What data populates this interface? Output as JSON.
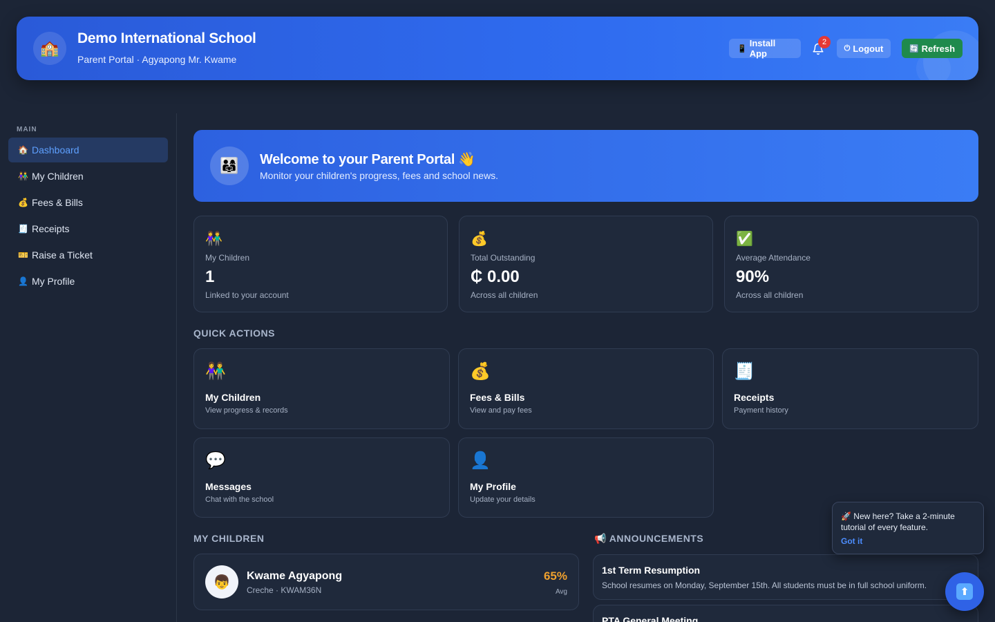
{
  "header": {
    "logo_icon": "🏫",
    "title": "Demo International School",
    "subtitle": "Parent Portal · Agyapong Mr. Kwame",
    "install_icon": "📱",
    "install_label": "Install App",
    "notification_count": "2",
    "logout_icon": "⏻",
    "logout_label": "Logout",
    "refresh_icon": "🔄",
    "refresh_label": "Refresh"
  },
  "sidebar": {
    "section": "MAIN",
    "items": [
      {
        "icon": "🏠",
        "label": "Dashboard",
        "active": true
      },
      {
        "icon": "👫",
        "label": "My Children"
      },
      {
        "icon": "💰",
        "label": "Fees & Bills"
      },
      {
        "icon": "🧾",
        "label": "Receipts"
      },
      {
        "icon": "🎫",
        "label": "Raise a Ticket"
      },
      {
        "icon": "👤",
        "label": "My Profile"
      }
    ]
  },
  "welcome": {
    "avatar_icon": "👨‍👩‍👧",
    "title": "Welcome to your Parent Portal 👋",
    "subtitle": "Monitor your children's progress, fees and school news."
  },
  "stats": [
    {
      "icon": "👫",
      "label": "My Children",
      "value": "1",
      "note": "Linked to your account"
    },
    {
      "icon": "💰",
      "label": "Total Outstanding",
      "value": "₵ 0.00",
      "note": "Across all children"
    },
    {
      "icon": "✅",
      "label": "Average Attendance",
      "value": "90%",
      "note": "Across all children"
    }
  ],
  "quick_actions": {
    "title": "QUICK ACTIONS",
    "items": [
      {
        "icon": "👫",
        "title": "My Children",
        "desc": "View progress & records"
      },
      {
        "icon": "💰",
        "title": "Fees & Bills",
        "desc": "View and pay fees"
      },
      {
        "icon": "🧾",
        "title": "Receipts",
        "desc": "Payment history"
      },
      {
        "icon": "💬",
        "title": "Messages",
        "desc": "Chat with the school"
      },
      {
        "icon": "👤",
        "title": "My Profile",
        "desc": "Update your details"
      }
    ]
  },
  "children": {
    "title": "MY CHILDREN",
    "items": [
      {
        "avatar_icon": "👦",
        "name": "Kwame Agyapong",
        "meta": "Creche · KWAM36N",
        "avg": "65%",
        "avg_label": "Avg"
      }
    ]
  },
  "announcements": {
    "title": "📢 ANNOUNCEMENTS",
    "items": [
      {
        "title": "1st Term Resumption",
        "desc": "School resumes on Monday, September 15th. All students must be in full school uniform."
      },
      {
        "title": "PTA General Meeting",
        "desc": ""
      }
    ]
  },
  "tutorial": {
    "message": "🚀 New here? Take a 2-minute tutorial of every feature.",
    "action": "Got it"
  },
  "fab": {
    "icon": "⬆"
  },
  "colors": {
    "accent": "#2f6cf0",
    "background": "#1c2536",
    "card": "#1f293b",
    "avg": "#f0a12e",
    "refresh": "#1f8a4c"
  }
}
